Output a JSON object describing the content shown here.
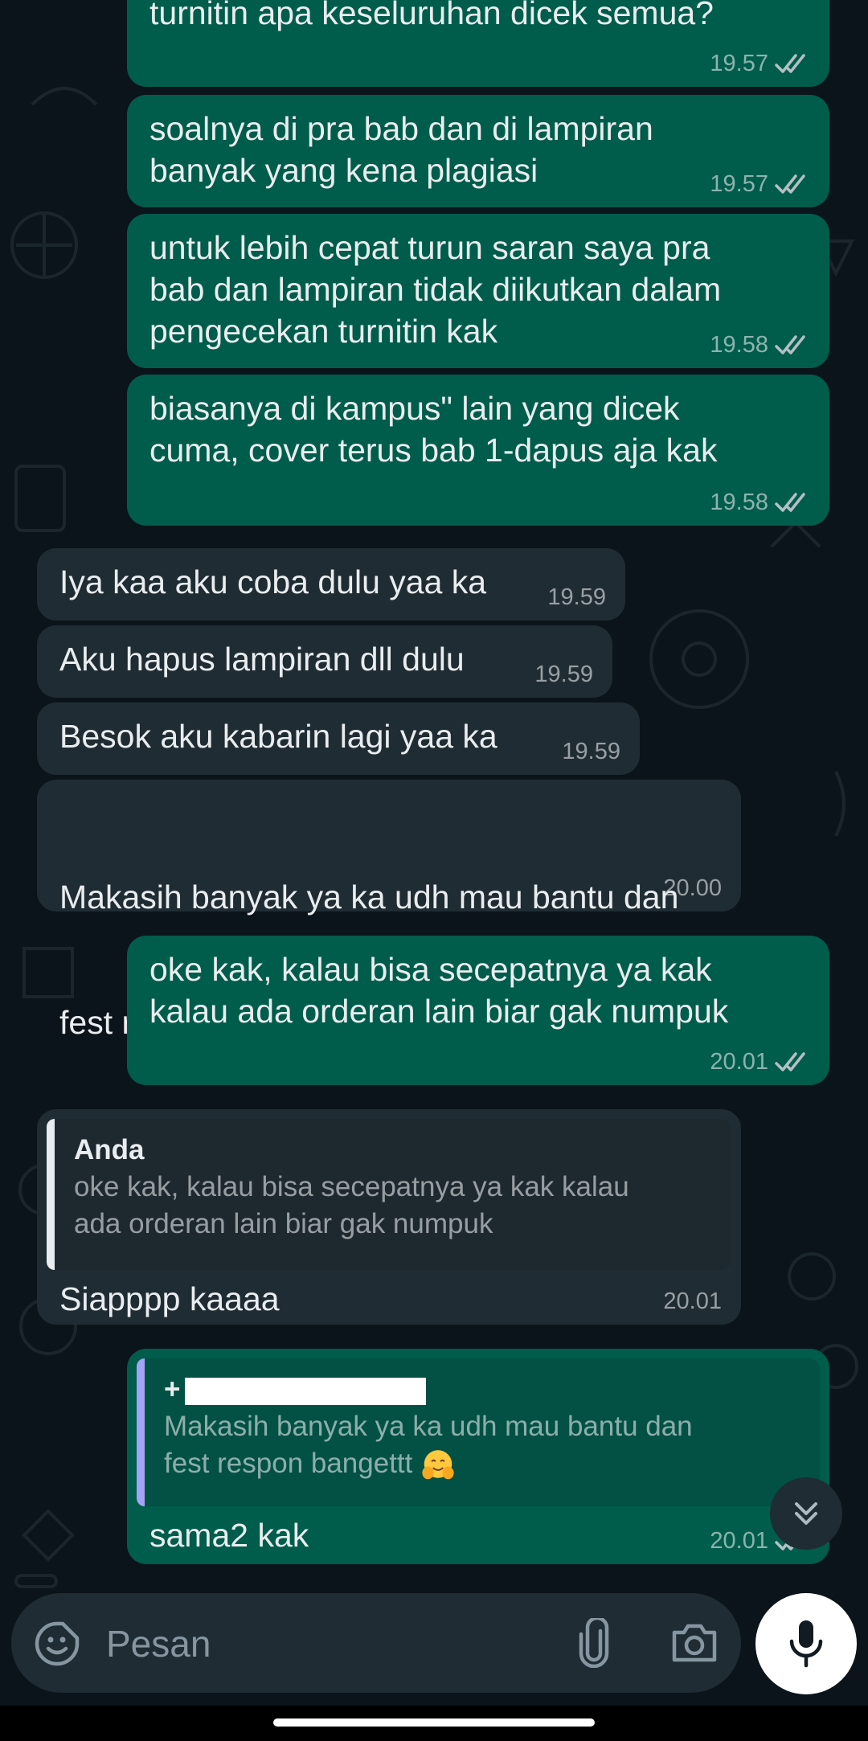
{
  "messages": [
    {
      "dir": "out",
      "text": "turnitin apa keseluruhan dicek semua?",
      "time": "19.57",
      "status": "read"
    },
    {
      "dir": "out",
      "text": "soalnya di pra bab dan di lampiran\nbanyak yang kena plagiasi",
      "time": "19.57",
      "status": "read"
    },
    {
      "dir": "out",
      "text": "untuk lebih cepat turun saran saya pra\nbab dan lampiran tidak diikutkan dalam\npengecekan turnitin kak",
      "time": "19.58",
      "status": "read"
    },
    {
      "dir": "out",
      "text": "biasanya di kampus\" lain yang dicek\ncuma, cover terus bab 1-dapus aja kak",
      "time": "19.58",
      "status": "read"
    },
    {
      "dir": "in",
      "text": "Iya kaa aku coba dulu yaa ka",
      "time": "19.59"
    },
    {
      "dir": "in",
      "text": "Aku hapus lampiran dll dulu",
      "time": "19.59"
    },
    {
      "dir": "in",
      "text": "Besok aku kabarin lagi yaa ka",
      "time": "19.59"
    },
    {
      "dir": "in",
      "text_line1": "Makasih banyak ya ka udh mau bantu dan",
      "text_line2": "fest respon bangettt",
      "emoji": "hugging-face",
      "time": "20.00"
    },
    {
      "dir": "out",
      "text": "oke kak, kalau bisa secepatnya ya kak\nkalau ada orderan lain biar gak numpuk",
      "time": "20.01",
      "status": "read"
    },
    {
      "dir": "in",
      "quote_author": "Anda",
      "quote_text": "oke kak, kalau bisa secepatnya ya kak kalau\nada orderan lain biar gak numpuk",
      "text": "Siapppp kaaaa",
      "time": "20.01"
    },
    {
      "dir": "out",
      "quote_author": "+",
      "quote_text_line1": "Makasih banyak ya ka udh mau bantu dan",
      "quote_text_line2": "fest respon bangettt",
      "text": "sama2 kak",
      "time": "20.01",
      "status": "read"
    }
  ],
  "composer": {
    "placeholder": "Pesan",
    "emoji_icon": "sticker-smile-icon",
    "attach_icon": "paperclip-icon",
    "camera_icon": "camera-icon",
    "mic_icon": "microphone-icon"
  },
  "colors": {
    "background": "#0b141a",
    "outgoing_bubble": "#005c4b",
    "incoming_bubble": "#202c33",
    "read_ticks": "#b5bfc4",
    "quote_bar_out": "#a5a3f5"
  }
}
